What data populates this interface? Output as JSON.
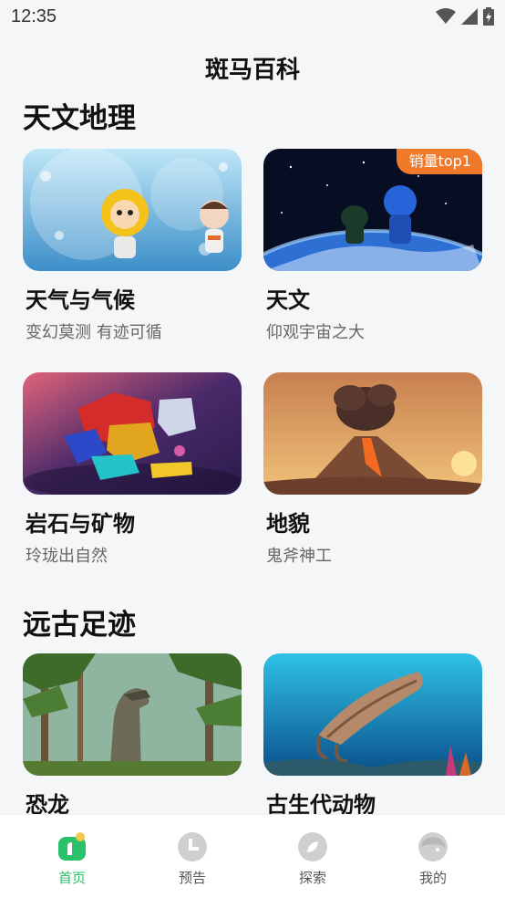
{
  "status_bar": {
    "time": "12:35"
  },
  "header": {
    "title": "斑马百科"
  },
  "sections": [
    {
      "title": "天文地理",
      "cards": [
        {
          "title": "天气与气候",
          "subtitle": "变幻莫测 有迹可循",
          "image": "bubbles-astronauts"
        },
        {
          "title": "天文",
          "subtitle": "仰观宇宙之大",
          "image": "earth-from-space",
          "badge": "销量top1"
        },
        {
          "title": "岩石与矿物",
          "subtitle": "玲珑出自然",
          "image": "gemstones"
        },
        {
          "title": "地貌",
          "subtitle": "鬼斧神工",
          "image": "volcano"
        }
      ]
    },
    {
      "title": "远古足迹",
      "cards": [
        {
          "title": "恐龙",
          "subtitle": "",
          "image": "dinosaur-forest"
        },
        {
          "title": "古生代动物",
          "subtitle": "",
          "image": "anomalocaris"
        }
      ]
    }
  ],
  "tab_bar": {
    "tabs": [
      {
        "label": "首页",
        "icon": "home-icon",
        "active": true
      },
      {
        "label": "预告",
        "icon": "clock-icon",
        "active": false
      },
      {
        "label": "探索",
        "icon": "compass-icon",
        "active": false
      },
      {
        "label": "我的",
        "icon": "profile-icon",
        "active": false
      }
    ]
  },
  "colors": {
    "accent": "#2bc06a",
    "badge": "#f07a2a",
    "background": "#f5f6f8"
  }
}
